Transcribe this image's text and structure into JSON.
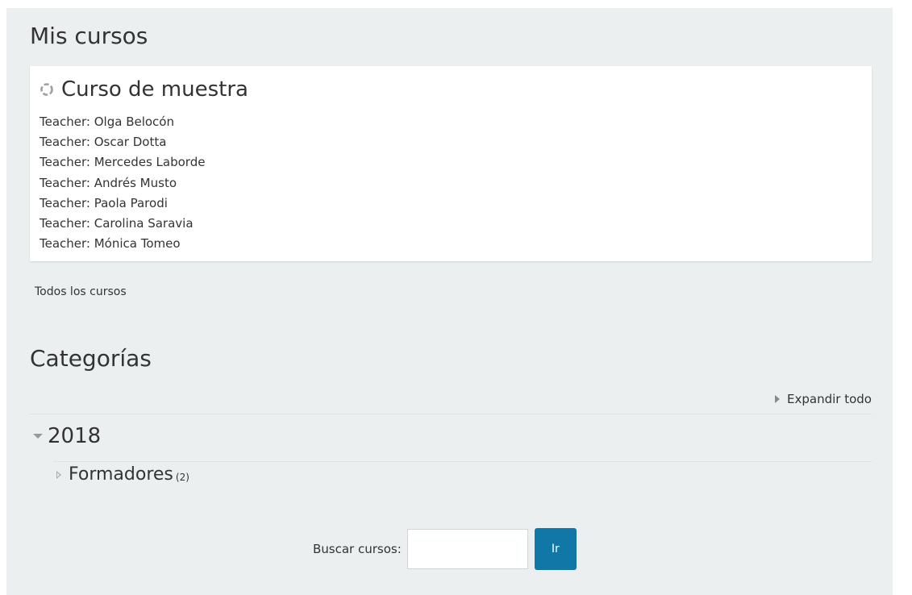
{
  "my_courses": {
    "title": "Mis cursos",
    "courses": [
      {
        "name": "Curso de muestra",
        "teachers": [
          "Teacher: Olga Belocón",
          "Teacher: Oscar Dotta",
          "Teacher: Mercedes Laborde",
          "Teacher: Andrés Musto",
          "Teacher: Paola Parodi",
          "Teacher: Carolina Saravia",
          "Teacher: Mónica Tomeo"
        ]
      }
    ],
    "all_courses_link": "Todos los cursos"
  },
  "categories": {
    "title": "Categorías",
    "expand_all": "Expandir todo",
    "items": [
      {
        "name": "2018",
        "expanded": true,
        "children": [
          {
            "name": "Formadores",
            "count": "(2)",
            "expanded": false
          }
        ]
      }
    ]
  },
  "search": {
    "label": "Buscar cursos:",
    "value": "",
    "button": "Ir"
  },
  "colors": {
    "background": "#eceff0",
    "card": "#ffffff",
    "button": "#1177a6"
  }
}
